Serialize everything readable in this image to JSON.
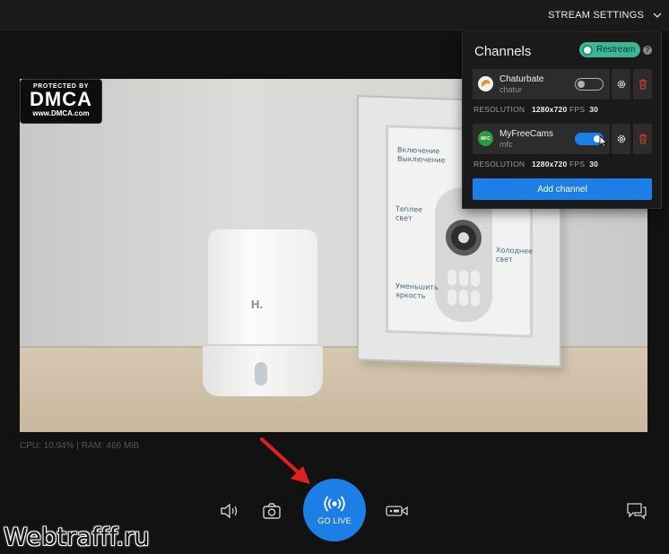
{
  "topbar": {
    "stream_settings_label": "STREAM SETTINGS"
  },
  "video": {
    "dmca": {
      "protected_by": "PROTECTED BY",
      "mark": "DMCA",
      "url": "www.DMCA.com"
    },
    "humidifier_logo": "H.",
    "poster_labels": {
      "on_off": "Включение\nВыключение",
      "warm": "Теплее\nсвет",
      "cold": "Холоднее\nсвет",
      "dim": "Уменьшить\nяркость"
    }
  },
  "stats": {
    "text": "CPU: 10.94% | RAM: 466 MiB"
  },
  "controls": {
    "go_live_label": "GO LIVE",
    "icons": [
      "speaker-icon",
      "camera-icon",
      "live-broadcast-icon",
      "record-icon",
      "chat-icon"
    ]
  },
  "channels_panel": {
    "title": "Channels",
    "restream_label": "Restream",
    "help_glyph": "?",
    "channels": [
      {
        "name": "Chaturbate",
        "username": "chatur",
        "enabled": false,
        "resolution_label": "RESOLUTION",
        "resolution": "1280x720",
        "fps_label": "FPS",
        "fps": "30"
      },
      {
        "name": "MyFreeCams",
        "username": "mfc",
        "icon_text": "MFC",
        "enabled": true,
        "resolution_label": "RESOLUTION",
        "resolution": "1280x720",
        "fps_label": "FPS",
        "fps": "30"
      }
    ],
    "add_channel_label": "Add channel"
  },
  "watermark": {
    "text": "Webtrafff.ru"
  },
  "colors": {
    "accent": "#1c7fe5",
    "restream": "#3db696",
    "delete": "#c0392b",
    "background": "#121212",
    "panel": "#1a1a1a",
    "annotation_arrow": "#e02020"
  }
}
